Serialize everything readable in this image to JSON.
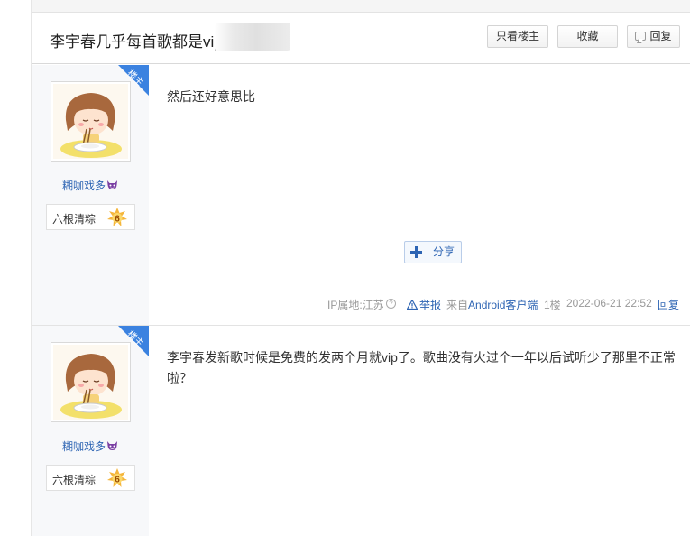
{
  "thread": {
    "title": "李宇春几乎每首歌都是vip",
    "buttons": {
      "only_lz": "只看楼主",
      "favorite": "收藏",
      "reply": "回复"
    }
  },
  "posts": [
    {
      "badge": "楼主",
      "author": "糊咖戏多",
      "level_title": "六根清粽",
      "level": "6",
      "content": "然后还好意思比",
      "share_label": "分享",
      "meta": {
        "ip_label": "IP属地:江苏",
        "report": "举报",
        "from_prefix": "来自",
        "from_client": "Android客户端",
        "floor": "1楼",
        "time": "2022-06-21 22:52",
        "reply": "回复"
      }
    },
    {
      "badge": "楼主",
      "author": "糊咖戏多",
      "level_title": "六根清粽",
      "level": "6",
      "content": "李宇春发新歌时候是免费的发两个月就vip了。歌曲没有火过个一年以后试听少了那里不正常啦？"
    }
  ],
  "colors": {
    "link_blue": "#2d64b3",
    "badge_blue": "#3b82e0",
    "author_bg": "#f7f8fa"
  }
}
